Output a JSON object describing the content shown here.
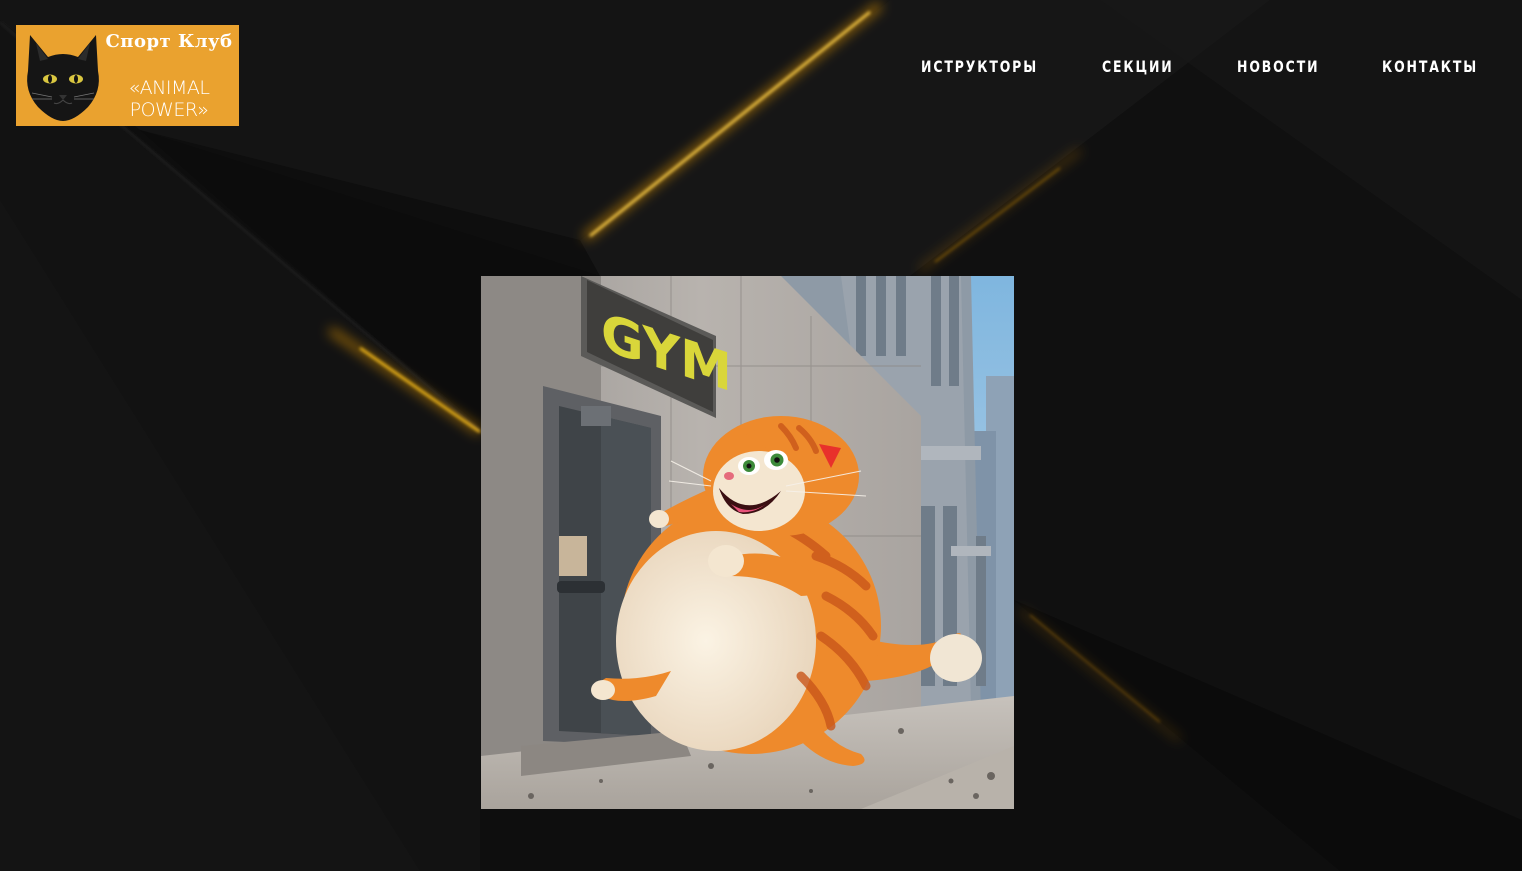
{
  "logo": {
    "line1": "Спорт  Клуб",
    "line2": "«ANIMAL",
    "line3": "POWER»",
    "icon": "black-cat-icon"
  },
  "nav": {
    "items": [
      {
        "label": "ИСТРУКТОРЫ"
      },
      {
        "label": "СЕКЦИИ"
      },
      {
        "label": "НОВОСТИ"
      },
      {
        "label": "КОНТАКТЫ"
      }
    ]
  },
  "hero": {
    "sign_text": "GYM"
  },
  "colors": {
    "background": "#0d0d0d",
    "logo_bg": "#eaa22f",
    "accent_gold": "#f2a100",
    "cat_orange": "#ee8a2c",
    "sign_yellow": "#d9d63a"
  }
}
